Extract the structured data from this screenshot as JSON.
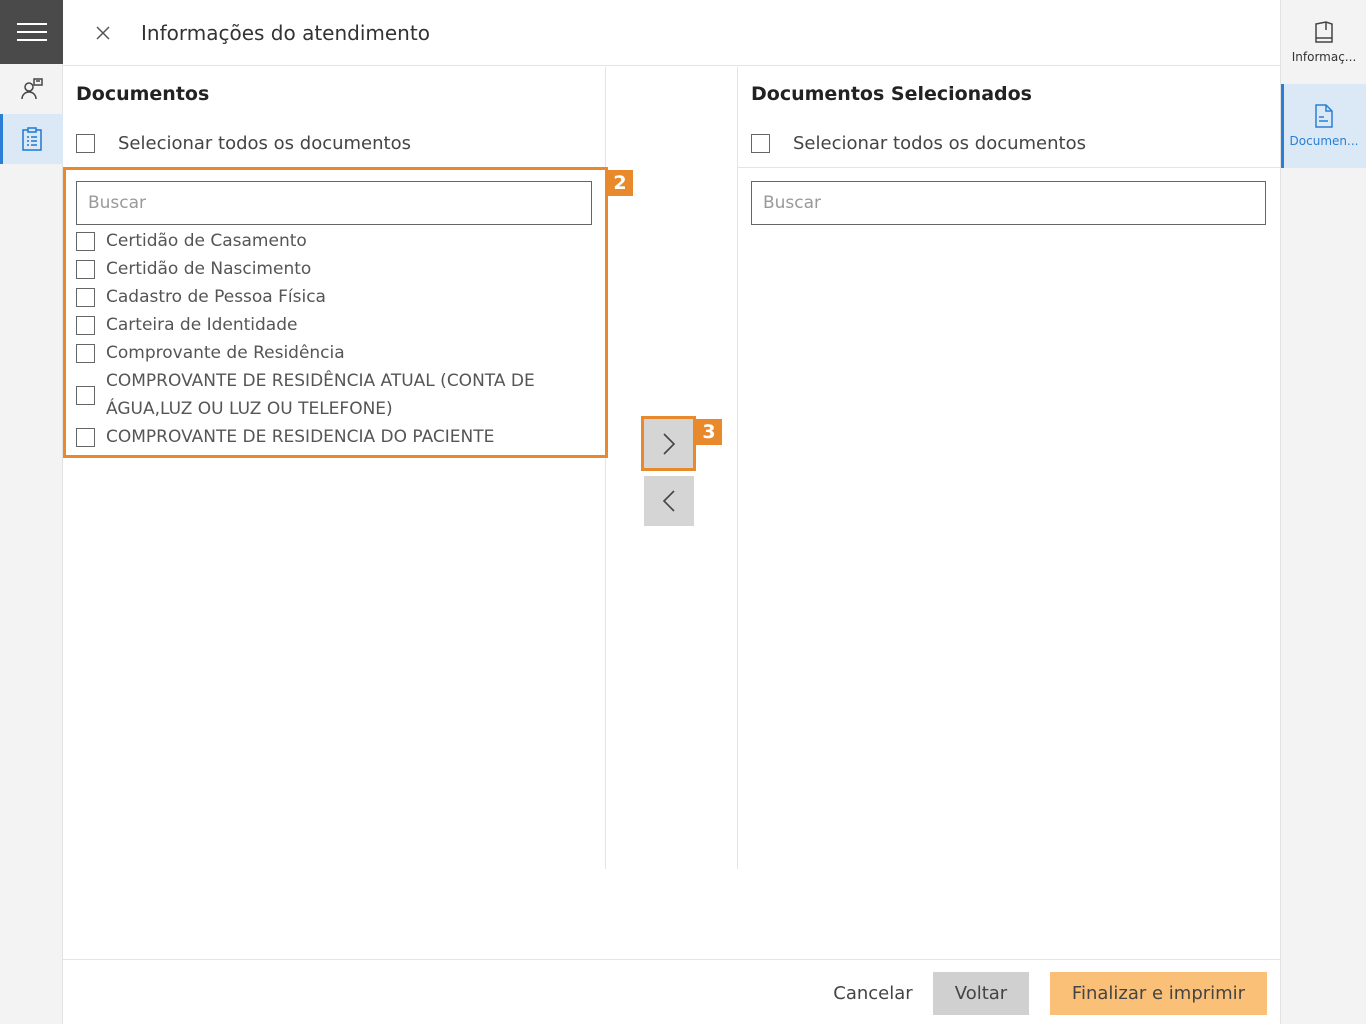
{
  "header": {
    "title": "Informações do atendimento"
  },
  "right_rail": {
    "items": [
      {
        "label": "Informaç..."
      },
      {
        "label": "Documen..."
      }
    ]
  },
  "left_panel": {
    "title": "Documentos",
    "select_all_label": "Selecionar todos os documentos",
    "search_placeholder": "Buscar",
    "documents": [
      "Certidão de Casamento",
      "Certidão de Nascimento",
      "Cadastro de Pessoa Física",
      "Carteira de Identidade",
      "Comprovante de Residência",
      "COMPROVANTE DE RESIDÊNCIA ATUAL (CONTA DE ÁGUA,LUZ OU LUZ OU TELEFONE)",
      "COMPROVANTE DE RESIDENCIA DO PACIENTE"
    ]
  },
  "right_panel": {
    "title": "Documentos Selecionados",
    "select_all_label": "Selecionar todos os documentos",
    "search_placeholder": "Buscar"
  },
  "annotations": {
    "badge_list": "2",
    "badge_arrow": "3"
  },
  "footer": {
    "cancel_label": "Cancelar",
    "back_label": "Voltar",
    "finish_label": "Finalizar e imprimir"
  },
  "colors": {
    "accent_orange": "#e8892b",
    "finish_button": "#fbc078",
    "active_blue": "#2a7fd4"
  }
}
